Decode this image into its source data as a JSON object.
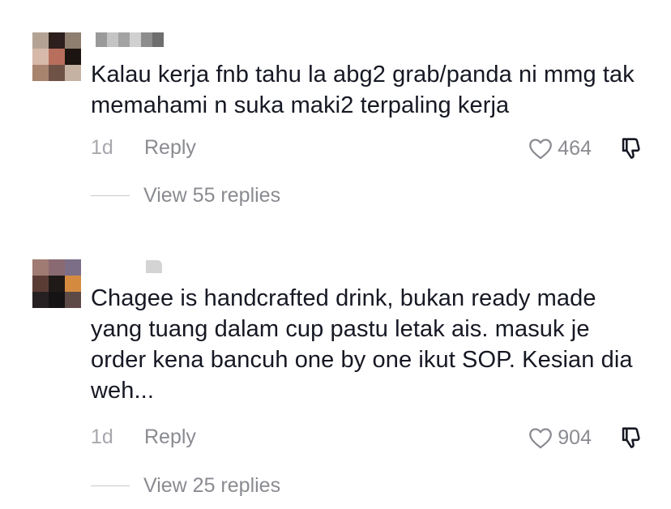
{
  "comments": [
    {
      "text": "Kalau kerja fnb tahu la abg2 grab/panda ni mmg tak memahami n suka maki2 terpaling kerja",
      "time": "1d",
      "reply_label": "Reply",
      "likes": "464",
      "view_replies": "View 55 replies",
      "avatar_colors": [
        "#b4a394",
        "#2c1f1c",
        "#8e7e70",
        "#d7b9aa",
        "#b86e5c",
        "#1c1410",
        "#a8836e",
        "#6f5246",
        "#c5b2a3"
      ]
    },
    {
      "text": "Chagee is handcrafted drink, bukan ready made yang tuang dalam cup pastu letak ais. masuk je order kena bancuh one by one ikut SOP. Kesian dia weh...",
      "time": "1d",
      "reply_label": "Reply",
      "likes": "904",
      "view_replies": "View 25 replies",
      "avatar_colors": [
        "#a07b73",
        "#8a6a72",
        "#7c6e87",
        "#5b3c35",
        "#1f1a18",
        "#d58b3f",
        "#262022",
        "#151313",
        "#5d4a47"
      ]
    }
  ],
  "colors": {
    "text": "#161823",
    "meta": "#8a8b91",
    "background": "#ffffff"
  },
  "icons": [
    "heart-outline-icon",
    "thumbs-down-icon"
  ]
}
